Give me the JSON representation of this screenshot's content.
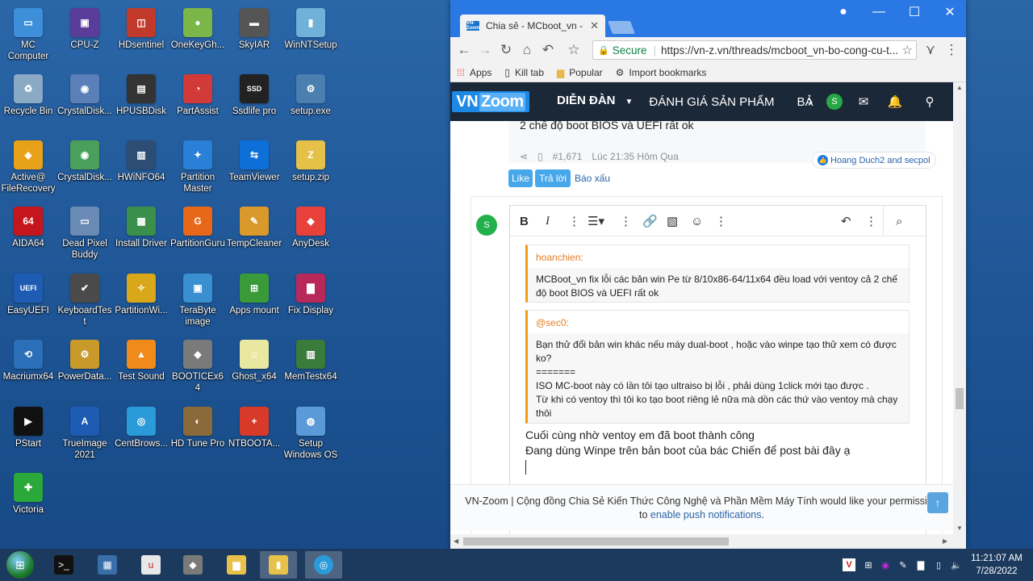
{
  "desktop": {
    "icons": [
      {
        "label": "MC Computer",
        "icon": "monitor-icon",
        "color": "#3c8fd8",
        "glyph": "▭"
      },
      {
        "label": "CPU-Z",
        "icon": "chip-icon",
        "color": "#5a3c9a",
        "glyph": "▣"
      },
      {
        "label": "HDsentinel",
        "icon": "harddisk-icon",
        "color": "#c0392b",
        "glyph": "◫"
      },
      {
        "label": "OneKeyGh...",
        "icon": "ghost-icon",
        "color": "#7ab648",
        "glyph": "●"
      },
      {
        "label": "SkyIAR",
        "icon": "drive-icon",
        "color": "#555555",
        "glyph": "▬"
      },
      {
        "label": "WinNTSetup",
        "icon": "setup-icon",
        "color": "#6fb1d9",
        "glyph": "▮"
      },
      {
        "label": "Recycle Bin",
        "icon": "recycle-bin-icon",
        "color": "#8aa9c4",
        "glyph": "♻"
      },
      {
        "label": "CrystalDisk...",
        "icon": "crystaldisk-icon",
        "color": "#5b7fb8",
        "glyph": "◉"
      },
      {
        "label": "HPUSBDisk",
        "icon": "usb-icon",
        "color": "#333333",
        "glyph": "▤"
      },
      {
        "label": "PartAssist",
        "icon": "partassist-icon",
        "color": "#d23a3a",
        "glyph": "◔"
      },
      {
        "label": "Ssdlife pro",
        "icon": "ssd-icon",
        "color": "#222222",
        "glyph": "SSD"
      },
      {
        "label": "setup.exe",
        "icon": "installer-icon",
        "color": "#4a7fb0",
        "glyph": "⚙"
      },
      {
        "label": "Active@ FileRecovery",
        "icon": "filerecovery-icon",
        "color": "#e8a21a",
        "glyph": "◈"
      },
      {
        "label": "CrystalDisk...",
        "icon": "crystaldisk-info-icon",
        "color": "#4aa05a",
        "glyph": "◉"
      },
      {
        "label": "HWiNFO64",
        "icon": "hwinfo-icon",
        "color": "#2d4d74",
        "glyph": "▥"
      },
      {
        "label": "Partition Master",
        "icon": "partition-master-icon",
        "color": "#2a7fd6",
        "glyph": "✦"
      },
      {
        "label": "TeamViewer",
        "icon": "teamviewer-icon",
        "color": "#0e6fd8",
        "glyph": "⇆"
      },
      {
        "label": "setup.zip",
        "icon": "zip-folder-icon",
        "color": "#e5c14a",
        "glyph": "Z"
      },
      {
        "label": "AIDA64",
        "icon": "aida64-icon",
        "color": "#c4161c",
        "glyph": "64"
      },
      {
        "label": "Dead Pixel Buddy",
        "icon": "laptop-icon",
        "color": "#6a8bb5",
        "glyph": "▭"
      },
      {
        "label": "Install Driver",
        "icon": "driver-icon",
        "color": "#3a8f4a",
        "glyph": "▦"
      },
      {
        "label": "PartitionGuru",
        "icon": "partitionguru-icon",
        "color": "#e8681a",
        "glyph": "G"
      },
      {
        "label": "TempCleaner",
        "icon": "broom-icon",
        "color": "#d99a2b",
        "glyph": "✎"
      },
      {
        "label": "AnyDesk",
        "icon": "anydesk-icon",
        "color": "#e8403a",
        "glyph": "◆"
      },
      {
        "label": "EasyUEFI",
        "icon": "easyuefi-icon",
        "color": "#1e5cb3",
        "glyph": "UEFI"
      },
      {
        "label": "KeyboardTest",
        "icon": "keyboard-icon",
        "color": "#4a4a4a",
        "glyph": "✔"
      },
      {
        "label": "PartitionWi...",
        "icon": "partitionwizard-icon",
        "color": "#d8a81a",
        "glyph": "✧"
      },
      {
        "label": "TeraByte image",
        "icon": "terabyte-icon",
        "color": "#3a8fd0",
        "glyph": "▣"
      },
      {
        "label": "Apps mount",
        "icon": "windows-orb-icon",
        "color": "#3a9a3a",
        "glyph": "⊞"
      },
      {
        "label": "Fix Display",
        "icon": "display-icon",
        "color": "#b8285a",
        "glyph": "▇"
      },
      {
        "label": "Macriumx64",
        "icon": "macrium-icon",
        "color": "#2a6fb8",
        "glyph": "⟲"
      },
      {
        "label": "PowerData...",
        "icon": "powerdata-icon",
        "color": "#c89a2a",
        "glyph": "⚙"
      },
      {
        "label": "Test Sound",
        "icon": "vlc-icon",
        "color": "#f08a1a",
        "glyph": "▲"
      },
      {
        "label": "BOOTICEx64",
        "icon": "bootice-icon",
        "color": "#7a7a7a",
        "glyph": "◆"
      },
      {
        "label": "Ghost_x64",
        "icon": "ghost-x64-icon",
        "color": "#e8e8a0",
        "glyph": "☺"
      },
      {
        "label": "MemTestx64",
        "icon": "memory-icon",
        "color": "#3a7a3a",
        "glyph": "▥"
      },
      {
        "label": "PStart",
        "icon": "play-icon",
        "color": "#111111",
        "glyph": "▶"
      },
      {
        "label": "TrueImage 2021",
        "icon": "trueimage-icon",
        "color": "#1e5cb3",
        "glyph": "A"
      },
      {
        "label": "CentBrows...",
        "icon": "centbrowser-icon",
        "color": "#2a9ad8",
        "glyph": "◎"
      },
      {
        "label": "HD Tune Pro",
        "icon": "hdtune-icon",
        "color": "#8a6a3a",
        "glyph": "◐"
      },
      {
        "label": "NTBOOTA...",
        "icon": "firstaid-icon",
        "color": "#d83a2a",
        "glyph": "+"
      },
      {
        "label": "Setup Windows OS",
        "icon": "windows-setup-icon",
        "color": "#5a9ad8",
        "glyph": "◍"
      },
      {
        "label": "Victoria",
        "icon": "victoria-cross-icon",
        "color": "#2aa83a",
        "glyph": "✚"
      }
    ]
  },
  "browser": {
    "tab_title": "Chia sẻ - MCboot_vn - Bộ",
    "tab_favicon_text": "VN-Zoom",
    "omnibox": {
      "secure_label": "Secure",
      "url": "https://vn-z.vn/threads/mcboot_vn-bo-cong-cu-t..."
    },
    "bookmarks": [
      {
        "label": "Apps",
        "icon": "apps-grid-icon"
      },
      {
        "label": "Kill tab",
        "icon": "page-icon"
      },
      {
        "label": "Popular",
        "icon": "folder-icon"
      },
      {
        "label": "Import bookmarks",
        "icon": "gear-icon"
      }
    ]
  },
  "site": {
    "logo_vn": "VN",
    "logo_zoom": "Zoom",
    "nav": [
      "DIỄN ĐÀN",
      "ĐÁNH GIÁ SẢN PHẨM",
      "BẢ"
    ],
    "user_initial": "S",
    "accent_color": "#1e88e5"
  },
  "post": {
    "snippet": "2 chế độ boot BIOS và UEFI rất ok",
    "post_number": "#1,671",
    "time": "Lúc 21:35 Hôm Qua",
    "reactions": "Hoang Duch2 and secpol",
    "like_label": "Like",
    "reply_label": "Trả lời",
    "report_label": "Báo xấu"
  },
  "reply": {
    "avatar_initial": "S",
    "quote1_author": "hoanchien:",
    "quote1_text": "MCBoot_vn fix lỗi các bản win Pe từ 8/10x86-64/11x64 đều load với ventoy cả 2 chế độ boot BIOS và UEFI rất ok",
    "quote2_author": "@sec0:",
    "quote2_line1": "Bạn thử đổi bản win khác nếu máy dual-boot , hoặc vào winpe tạo thử xem có được ko?",
    "quote2_line2": "=======",
    "quote2_line3": "ISO MC-boot này có lần tôi tạo ultraiso bị lỗi , phải dùng 1click mới tạo được .",
    "quote2_line4": "Từ khi có ventoy thì tôi ko tạo boot riêng lẻ nữa mà dồn các thứ vào ventoy mà chạy thôi",
    "typed_line1": "Cuối cùng nhờ ventoy em đã boot thành công",
    "typed_line2": "Đang dùng Winpe trên bản boot của bác Chiến để post bài đây ạ"
  },
  "push": {
    "text": "VN-Zoom | Cộng đồng Chia Sẻ Kiến Thức Công Nghệ và Phần Mềm Máy Tính would like your permission",
    "to": "to",
    "link": "enable push notifications",
    "dot": "."
  },
  "taskbar": {
    "time": "11:21:07 AM",
    "date": "7/28/2022"
  }
}
